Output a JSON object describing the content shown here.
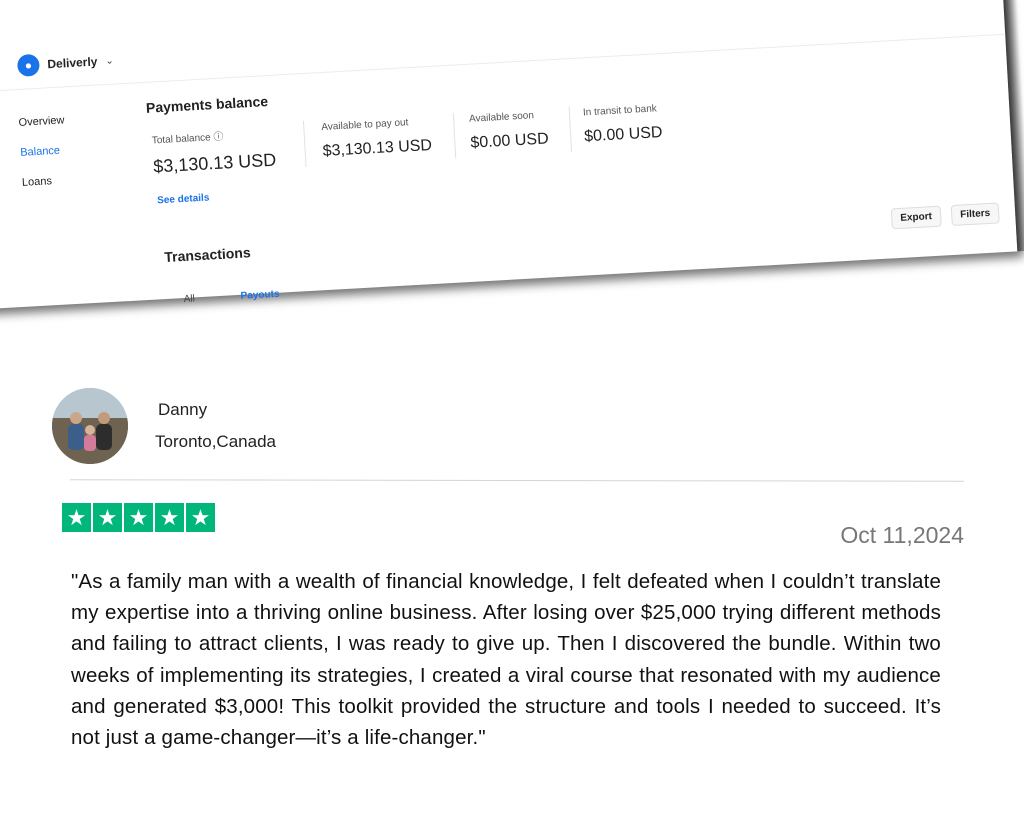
{
  "dashboard": {
    "brand": {
      "name": "Deliverly"
    },
    "nav": [
      {
        "label": "Overview"
      },
      {
        "label": "Balance"
      },
      {
        "label": "Loans"
      }
    ],
    "payments_title": "Payments balance",
    "balances": [
      {
        "label": "Total balance ⓘ",
        "value": "$3,130.13 USD"
      },
      {
        "label": "Available to pay out",
        "value": "$3,130.13 USD"
      },
      {
        "label": "Available soon",
        "value": "$0.00 USD"
      },
      {
        "label": "In transit to bank",
        "value": "$0.00 USD"
      }
    ],
    "see_details": "See details",
    "transactions_title": "Transactions",
    "export_label": "Export",
    "filters_label": "Filters",
    "tabs": [
      {
        "label": "All"
      },
      {
        "label": "Payouts"
      }
    ],
    "accent_color": "#f08a24",
    "link_color": "#1a73e8"
  },
  "review": {
    "name": "Danny",
    "location": "Toronto,Canada",
    "rating": 5,
    "star_color": "#00b67a",
    "date": "Oct 11,2024",
    "text": "\"As a family man with a wealth of financial knowledge, I felt defeated when I couldn’t translate my expertise into a thriving online business. After losing over $25,000 trying different methods and failing to attract clients, I was ready to give up. Then I discovered the bundle. Within two weeks of implementing its strategies, I created a viral course that resonated with my audience and generated $3,000! This toolkit provided the structure and tools I needed to succeed. It’s not just a game-changer—it’s a life-changer.\""
  }
}
